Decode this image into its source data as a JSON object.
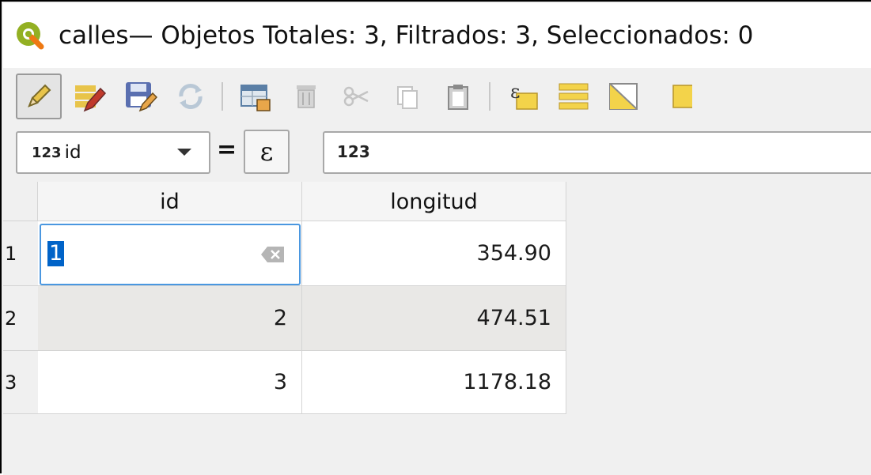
{
  "window": {
    "title": "calles— Objetos Totales: 3, Filtrados: 3, Seleccionados: 0",
    "app_icon": "qgis-logo"
  },
  "toolbar": {
    "buttons": [
      {
        "name": "toggle-editing",
        "icon": "pencil-icon",
        "active": true
      },
      {
        "name": "toggle-multi-edit",
        "icon": "multi-edit-icon"
      },
      {
        "name": "save-edits",
        "icon": "save-edits-icon"
      },
      {
        "name": "reload-table",
        "icon": "refresh-icon"
      },
      {
        "name": "add-feature",
        "icon": "add-feature-icon"
      },
      {
        "name": "delete-feature",
        "icon": "delete-icon"
      },
      {
        "name": "cut",
        "icon": "cut-icon"
      },
      {
        "name": "copy",
        "icon": "copy-icon"
      },
      {
        "name": "paste",
        "icon": "paste-icon"
      },
      {
        "name": "select-by-expression",
        "icon": "expression-select-icon"
      },
      {
        "name": "select-all",
        "icon": "select-all-icon"
      },
      {
        "name": "invert-selection",
        "icon": "invert-selection-icon"
      },
      {
        "name": "deselect-all",
        "icon": "deselect-icon"
      }
    ]
  },
  "field_calc": {
    "field_type": "123",
    "field_name": "id",
    "equals_label": "=",
    "expression_symbol": "ε",
    "value": "123"
  },
  "table": {
    "columns": [
      "id",
      "longitud"
    ],
    "rows": [
      {
        "row_num": "1",
        "id": "1",
        "longitud": "354.90"
      },
      {
        "row_num": "2",
        "id": "2",
        "longitud": "474.51"
      },
      {
        "row_num": "3",
        "id": "3",
        "longitud": "1178.18"
      }
    ]
  },
  "colors": {
    "accent": "#0063c8",
    "selection_border": "#4a97e0"
  }
}
